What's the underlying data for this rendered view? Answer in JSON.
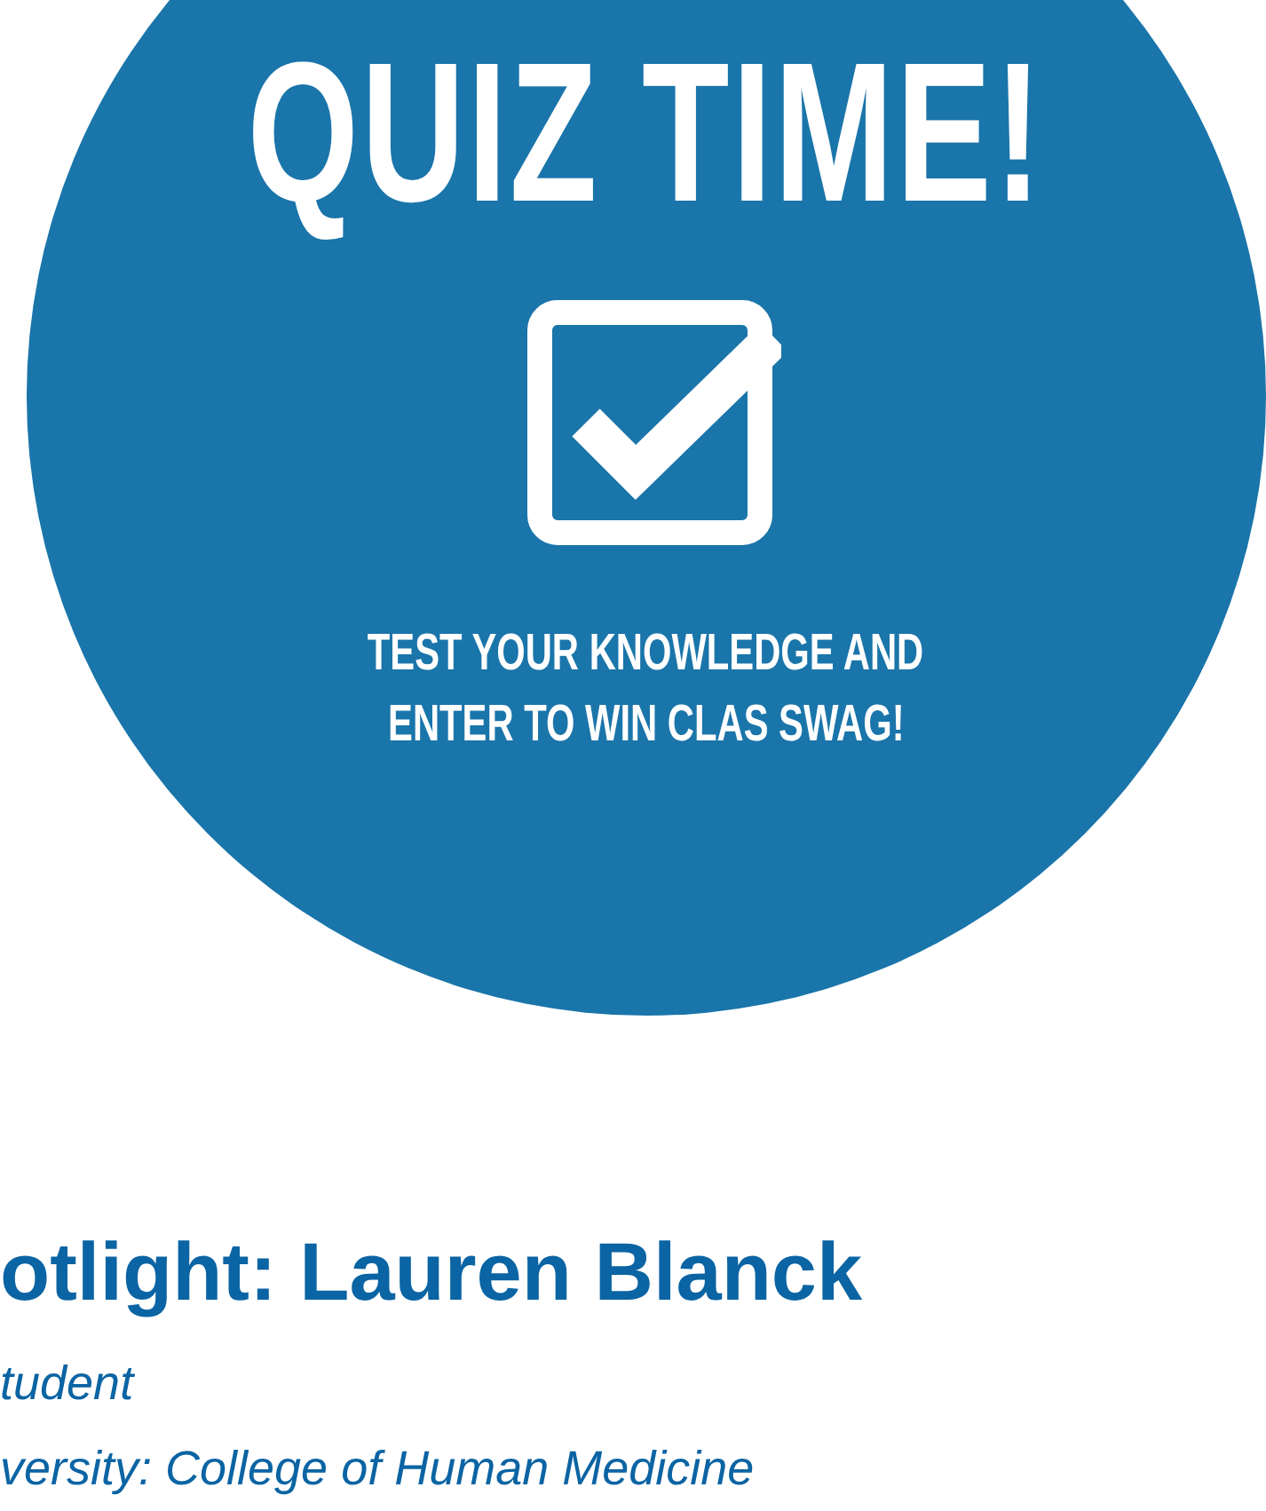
{
  "banner": {
    "title": "QUIZ TIME!",
    "subtitle_lines": [
      "TEST YOUR KNOWLEDGE AND",
      "ENTER TO WIN CLAS SWAG!"
    ]
  },
  "article": {
    "heading": "otlight: Lauren Blanck",
    "details": [
      "tudent",
      "versity: College of Human Medicine"
    ]
  }
}
